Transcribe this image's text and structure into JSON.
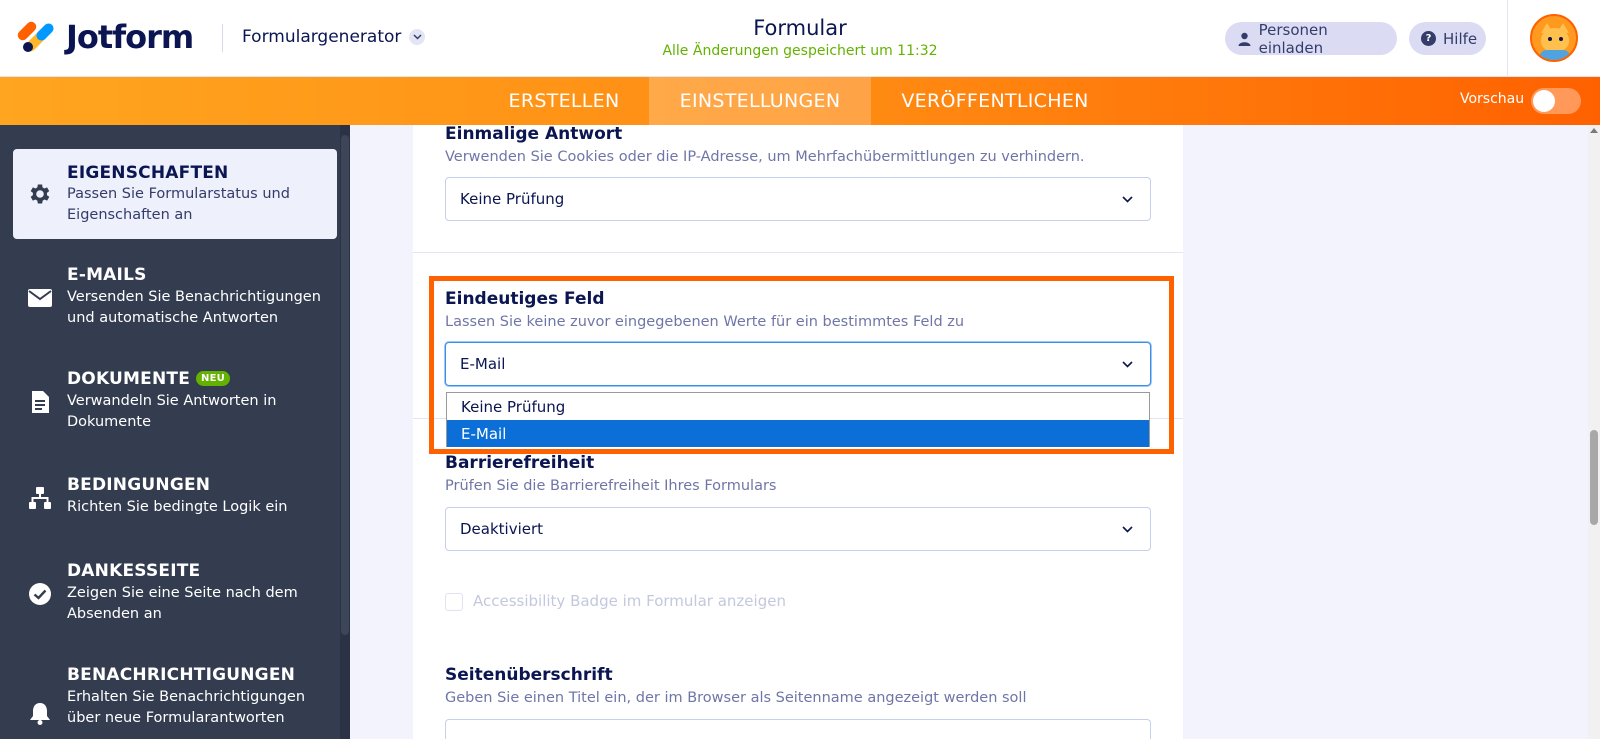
{
  "header": {
    "logo_text": "Jotform",
    "builder_menu": "Formulargenerator",
    "form_title": "Formular",
    "saved_status": "Alle Änderungen gespeichert um 11:32",
    "invite_label": "Personen einladen",
    "help_label": "Hilfe"
  },
  "nav": {
    "tabs": [
      {
        "label": "ERSTELLEN"
      },
      {
        "label": "EINSTELLUNGEN",
        "active": true
      },
      {
        "label": "VERÖFFENTLICHEN"
      }
    ],
    "preview_label": "Vorschau",
    "preview_enabled": false
  },
  "sidebar": {
    "items": [
      {
        "title": "EIGENSCHAFTEN",
        "desc": "Passen Sie Formularstatus und Eigenschaften an",
        "active": true,
        "icon": "gear-icon"
      },
      {
        "title": "E-MAILS",
        "desc": "Versenden Sie Benachrichtigungen und automatische Antworten",
        "icon": "envelope-icon"
      },
      {
        "title": "DOKUMENTE",
        "badge": "NEU",
        "desc": "Verwandeln Sie Antworten in Dokumente",
        "icon": "document-icon"
      },
      {
        "title": "BEDINGUNGEN",
        "desc": "Richten Sie bedingte Logik ein",
        "icon": "hierarchy-icon"
      },
      {
        "title": "DANKESSEITE",
        "desc": "Zeigen Sie eine Seite nach dem Absenden an",
        "icon": "check-circle-icon"
      },
      {
        "title": "BENACHRICHTIGUNGEN",
        "desc": "Erhalten Sie Benachrichtigungen über neue Formularantworten",
        "icon": "bell-icon"
      }
    ]
  },
  "settings": {
    "single_answer": {
      "title": "Einmalige Antwort",
      "desc": "Verwenden Sie Cookies oder die IP-Adresse, um Mehrfachübermittlungen zu verhindern.",
      "value": "Keine Prüfung"
    },
    "unique_field": {
      "title": "Eindeutiges Feld",
      "desc": "Lassen Sie keine zuvor eingegebenen Werte für ein bestimmtes Feld zu",
      "value": "E-Mail",
      "options": [
        "Keine Prüfung",
        "E-Mail"
      ],
      "selected_option": "E-Mail"
    },
    "accessibility": {
      "title": "Barrierefreiheit",
      "desc": "Prüfen Sie die Barrierefreiheit Ihres Formulars",
      "value": "Deaktiviert",
      "badge_checkbox_label": "Accessibility Badge im Formular anzeigen",
      "badge_checked": false
    },
    "page_title": {
      "title": "Seitenüberschrift",
      "desc": "Geben Sie einen Titel ein, der im Browser als Seitenname angezeigt werden soll"
    }
  },
  "colors": {
    "brand_orange": "#ff6100",
    "brand_navy": "#0a1551",
    "saved_green": "#64b200",
    "selected_blue": "#0b6fd7"
  }
}
